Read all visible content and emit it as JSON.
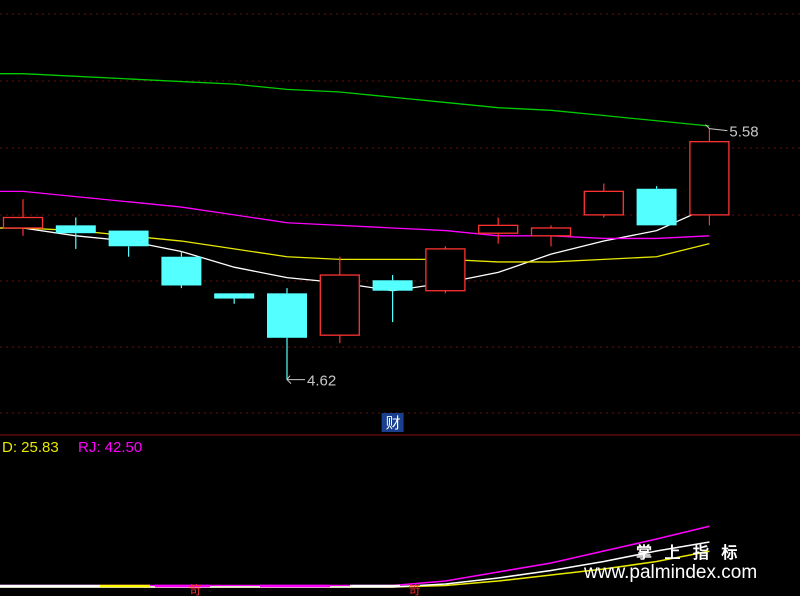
{
  "chart_data": {
    "type": "candlestick",
    "main_panel": {
      "ylim": [
        4.5,
        5.72
      ],
      "candles": [
        {
          "open": 5.2,
          "high": 5.31,
          "low": 5.17,
          "close": 5.24,
          "color": "red"
        },
        {
          "open": 5.21,
          "high": 5.24,
          "low": 5.12,
          "close": 5.18,
          "color": "cyan"
        },
        {
          "open": 5.19,
          "high": 5.19,
          "low": 5.09,
          "close": 5.13,
          "color": "cyan"
        },
        {
          "open": 5.09,
          "high": 5.11,
          "low": 4.97,
          "close": 4.98,
          "color": "cyan"
        },
        {
          "open": 4.95,
          "high": 4.95,
          "low": 4.91,
          "close": 4.93,
          "color": "cyan"
        },
        {
          "open": 4.95,
          "high": 4.97,
          "low": 4.62,
          "close": 4.78,
          "color": "cyan"
        },
        {
          "open": 4.79,
          "high": 5.09,
          "low": 4.76,
          "close": 5.02,
          "color": "red"
        },
        {
          "open": 5.0,
          "high": 5.02,
          "low": 4.84,
          "close": 4.96,
          "color": "cyan"
        },
        {
          "open": 4.96,
          "high": 5.13,
          "low": 4.95,
          "close": 5.12,
          "color": "red"
        },
        {
          "open": 5.18,
          "high": 5.24,
          "low": 5.14,
          "close": 5.21,
          "color": "red"
        },
        {
          "open": 5.17,
          "high": 5.21,
          "low": 5.13,
          "close": 5.2,
          "color": "red"
        },
        {
          "open": 5.25,
          "high": 5.37,
          "low": 5.24,
          "close": 5.34,
          "color": "red"
        },
        {
          "open": 5.35,
          "high": 5.36,
          "low": 5.21,
          "close": 5.21,
          "color": "cyan"
        },
        {
          "open": 5.25,
          "high": 5.58,
          "low": 5.21,
          "close": 5.53,
          "color": "red"
        }
      ],
      "ma_lines": [
        {
          "color": "#ffffff",
          "values": [
            5.2,
            5.17,
            5.15,
            5.11,
            5.05,
            5.01,
            4.99,
            4.96,
            4.99,
            5.03,
            5.1,
            5.15,
            5.19,
            5.28
          ]
        },
        {
          "color": "#e8e800",
          "values": [
            5.2,
            5.19,
            5.17,
            5.15,
            5.12,
            5.09,
            5.08,
            5.08,
            5.08,
            5.07,
            5.07,
            5.08,
            5.09,
            5.14
          ]
        },
        {
          "color": "#ff00ff",
          "values": [
            5.34,
            5.32,
            5.3,
            5.28,
            5.25,
            5.22,
            5.21,
            5.2,
            5.19,
            5.17,
            5.17,
            5.16,
            5.16,
            5.17
          ]
        },
        {
          "color": "#00cc00",
          "values": [
            5.79,
            5.78,
            5.77,
            5.76,
            5.75,
            5.73,
            5.72,
            5.7,
            5.68,
            5.66,
            5.65,
            5.63,
            5.61,
            5.59
          ]
        }
      ],
      "annotations": {
        "high_label": "5.58",
        "low_label": "4.62",
        "event_marker": "财"
      }
    },
    "indicator_panel": {
      "legend": [
        {
          "text": "D: 25.83",
          "color": "#e8e800"
        },
        {
          "text": "RJ: 42.50",
          "color": "#ff00ff"
        }
      ],
      "ylim": [
        0,
        100
      ],
      "series": [
        {
          "name": "RJ",
          "color": "#ff00ff",
          "values": [
            3,
            3,
            3,
            3,
            3,
            3,
            3,
            3,
            6,
            12,
            18,
            26,
            34,
            42.5
          ]
        },
        {
          "name": "D",
          "color": "#e8e800",
          "values": [
            2,
            2,
            2,
            2,
            2,
            2,
            2,
            2,
            3,
            6,
            10,
            14,
            19,
            25.83
          ]
        },
        {
          "color": "#ffffff",
          "values": [
            2,
            2,
            2,
            2,
            2,
            2,
            2,
            2,
            4,
            8,
            13,
            19,
            26,
            32
          ]
        }
      ],
      "markers": [
        {
          "index": 3,
          "text": "笴"
        },
        {
          "index": 7,
          "text": "笴"
        }
      ]
    }
  },
  "watermark": {
    "line1": "掌 上 指 标",
    "line2": "www.palmindex.com"
  }
}
